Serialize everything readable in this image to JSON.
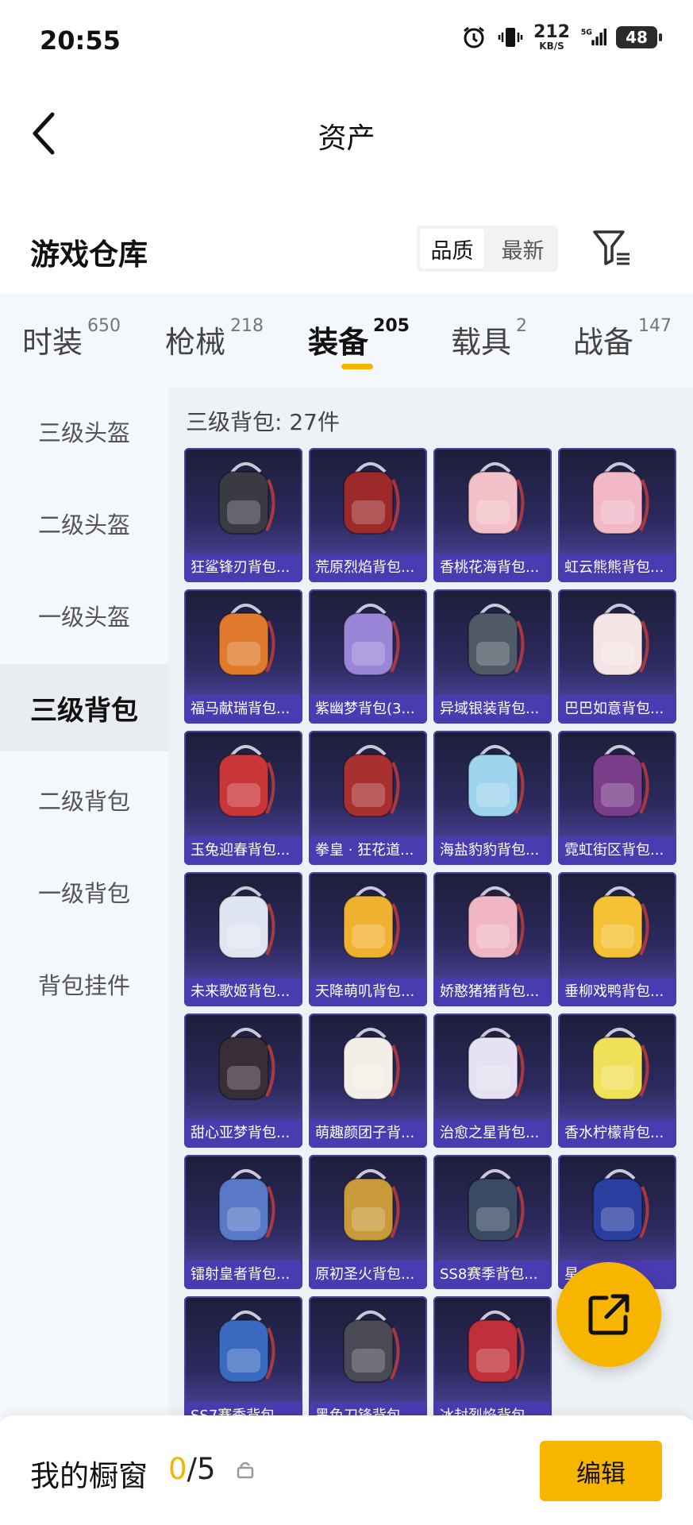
{
  "status_bar": {
    "time": "20:55",
    "speed_value": "212",
    "speed_unit": "KB/S",
    "network": "5G",
    "battery": "48"
  },
  "header": {
    "title": "资产"
  },
  "warehouse": {
    "title": "游戏仓库",
    "sort_options": [
      {
        "label": "品质",
        "active": true
      },
      {
        "label": "最新",
        "active": false
      }
    ]
  },
  "tabs": [
    {
      "label": "时装",
      "count": "650",
      "active": false
    },
    {
      "label": "枪械",
      "count": "218",
      "active": false
    },
    {
      "label": "装备",
      "count": "205",
      "active": true
    },
    {
      "label": "载具",
      "count": "2",
      "active": false
    },
    {
      "label": "战备",
      "count": "147",
      "active": false
    }
  ],
  "categories": [
    {
      "label": "三级头盔",
      "active": false
    },
    {
      "label": "二级头盔",
      "active": false
    },
    {
      "label": "一级头盔",
      "active": false
    },
    {
      "label": "三级背包",
      "active": true
    },
    {
      "label": "二级背包",
      "active": false
    },
    {
      "label": "一级背包",
      "active": false
    },
    {
      "label": "背包挂件",
      "active": false
    }
  ],
  "panel": {
    "count_text": "三级背包: 27件",
    "items": [
      {
        "name": "狂鲨锋刃背包...",
        "color": "#3a3a44"
      },
      {
        "name": "荒原烈焰背包...",
        "color": "#9c2a2a"
      },
      {
        "name": "香桃花海背包...",
        "color": "#f2c0c8"
      },
      {
        "name": "虹云熊熊背包...",
        "color": "#f3b8c8"
      },
      {
        "name": "福马献瑞背包...",
        "color": "#e07a2c"
      },
      {
        "name": "紫幽梦背包(3...",
        "color": "#9a86d8"
      },
      {
        "name": "异域银装背包...",
        "color": "#4f5a66"
      },
      {
        "name": "巴巴如意背包...",
        "color": "#f4e4e6"
      },
      {
        "name": "玉兔迎春背包...",
        "color": "#c8363a"
      },
      {
        "name": "拳皇 · 狂花道...",
        "color": "#a83030"
      },
      {
        "name": "海盐豹豹背包...",
        "color": "#9fd4ee"
      },
      {
        "name": "霓虹街区背包...",
        "color": "#7a3d8a"
      },
      {
        "name": "未来歌姬背包...",
        "color": "#dfe6f2"
      },
      {
        "name": "天降萌叽背包...",
        "color": "#f0b030"
      },
      {
        "name": "娇憨猪猪背包...",
        "color": "#f1b6c4"
      },
      {
        "name": "垂柳戏鸭背包...",
        "color": "#f4c234"
      },
      {
        "name": "甜心亚梦背包...",
        "color": "#3a2e36"
      },
      {
        "name": "萌趣颜团子背...",
        "color": "#f4efe6"
      },
      {
        "name": "治愈之星背包...",
        "color": "#e6e2f4"
      },
      {
        "name": "香水柠檬背包...",
        "color": "#f0e05a"
      },
      {
        "name": "镭射皇者背包...",
        "color": "#5a78c8"
      },
      {
        "name": "原初圣火背包...",
        "color": "#c89a3a"
      },
      {
        "name": "SS8赛季背包...",
        "color": "#3a4a62"
      },
      {
        "name": "星...",
        "color": "#2a3ea0"
      },
      {
        "name": "SS7赛季背包...",
        "color": "#3a6ac0"
      },
      {
        "name": "黑色刀锋背包...",
        "color": "#4a4a56"
      },
      {
        "name": "冰封烈焰背包...",
        "color": "#c0303a"
      }
    ]
  },
  "bottom_bar": {
    "label": "我的橱窗",
    "current": "0",
    "total": "/5",
    "edit_label": "编辑"
  },
  "colors": {
    "accent": "#f7b500",
    "card_bg": "#2c2a5e",
    "card_label_bg": "#4a3bb0"
  },
  "icons": {
    "back": "chevron-left-icon",
    "filter": "filter-icon",
    "share": "share-icon",
    "lock": "lock-icon",
    "alarm": "alarm-icon",
    "vibrate": "vibrate-icon"
  }
}
